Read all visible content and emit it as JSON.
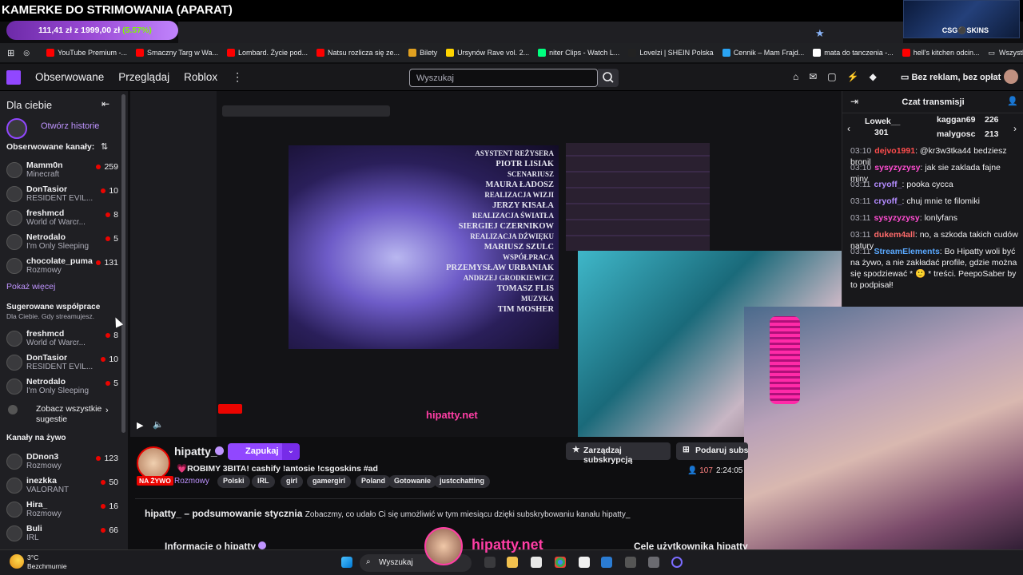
{
  "overlay": {
    "title": "KAMERKE DO STRIMOWANIA (APARAT)",
    "price_prefix": "111,41 zł z 1999,00 zł",
    "price_pct": "(5.57%)",
    "csgo_label": "CSG⚫SKINS"
  },
  "bookmarks": [
    {
      "label": "YouTube Premium -...",
      "color": "#ff0000"
    },
    {
      "label": "Smaczny Targ w Wa...",
      "color": "#ff0000"
    },
    {
      "label": "Lombard. Życie pod...",
      "color": "#ff0000"
    },
    {
      "label": "Natsu rozlicza się ze...",
      "color": "#ff0000"
    },
    {
      "label": "Bilety",
      "color": "#e0a020"
    },
    {
      "label": "Ursynów Rave vol. 2...",
      "color": "#ffd400"
    },
    {
      "label": "niter Clips - Watch L...",
      "color": "#00ff7f"
    },
    {
      "label": "Lovelzi | SHEIN Polska",
      "color": "#222222"
    },
    {
      "label": "Cennik – Mam Frajd...",
      "color": "#2aa4f4"
    },
    {
      "label": "mata do tanczenia -...",
      "color": "#ffffff"
    },
    {
      "label": "hell's kitchen odcin...",
      "color": "#ff0000"
    }
  ],
  "bookmarks_all": "Wszystkie zakładki",
  "nav": {
    "followed": "Obserwowane",
    "browse": "Przeglądaj",
    "roblox": "Roblox",
    "search_placeholder": "Wyszukaj",
    "no_ads": "Bez reklam, bez opłat"
  },
  "sidebar": {
    "for_you": "Dla ciebie",
    "open_stories": "Otwórz historie",
    "followed_header": "Obserwowane kanały:",
    "followed": [
      {
        "name": "Mamm0n",
        "game": "Minecraft",
        "count": "259"
      },
      {
        "name": "DonTasior",
        "game": "RESIDENT EVIL...",
        "count": "10"
      },
      {
        "name": "freshmcd",
        "game": "World of Warcr...",
        "count": "8"
      },
      {
        "name": "Netrodalo",
        "game": "I'm Only Sleeping",
        "count": "5"
      },
      {
        "name": "chocolate_puma",
        "game": "Rozmowy",
        "count": "131"
      }
    ],
    "show_more": "Pokaż więcej",
    "suggested_header": "Sugerowane współprace",
    "suggested_sub": "Dla Ciebie. Gdy streamujesz.",
    "suggested": [
      {
        "name": "freshmcd",
        "game": "World of Warcr...",
        "count": "8"
      },
      {
        "name": "DonTasior",
        "game": "RESIDENT EVIL...",
        "count": "10"
      },
      {
        "name": "Netrodalo",
        "game": "I'm Only Sleeping",
        "count": "5"
      }
    ],
    "see_all_suggestions": "Zobacz wszystkie sugestie",
    "live_header": "Kanały na żywo",
    "live": [
      {
        "name": "DDnon3",
        "game": "Rozmowy",
        "count": "123"
      },
      {
        "name": "inezkka",
        "game": "VALORANT",
        "count": "50"
      },
      {
        "name": "Hira_",
        "game": "Rozmowy",
        "count": "16"
      },
      {
        "name": "Buli",
        "game": "IRL",
        "count": "66"
      }
    ]
  },
  "player": {
    "credits": [
      "ASYSTENT REŻYSERA",
      "PIOTR LISIAK",
      "SCENARIUSZ",
      "MAURA ŁADOSZ",
      "REALIZACJA WIZJI",
      "JERZY KISAŁA",
      "REALIZACJA ŚWIATŁA",
      "SIERGIEJ CZERNIKOW",
      "REALIZACJA DŹWIĘKU",
      "MARIUSZ SZULC",
      "WSPÓŁPRACA",
      "PRZEMYSŁAW URBANIAK",
      "ANDRZEJ GRODKIEWICZ",
      "TOMASZ FLIS",
      "MUZYKA",
      "TIM MOSHER"
    ],
    "inner_watermark": "hipatty.net"
  },
  "channel": {
    "name": "hipatty_",
    "follow": "Zapukaj",
    "live": "NA ŻYWO",
    "title": "💗ROBIMY 3BITA! cashify !antosie !csgoskins #ad",
    "category": "Rozmowy",
    "tags": [
      "Polski",
      "IRL",
      "girl",
      "gamergirl",
      "Poland",
      "Gotowanie",
      "justcchatting"
    ],
    "manage_sub": "Zarządzaj subskrypcją",
    "gift_sub": "Podaruj subsk",
    "viewers": "107",
    "uptime": "2:24:05",
    "summary_title": "hipatty_ – podsumowanie stycznia",
    "summary_text": "Zobaczmy, co udało Ci się umożliwić w tym miesiącu dzięki subskrybowaniu kanału hipatty_",
    "about": "Informacje o hipatty",
    "goals": "Cele użytkownika hipatty"
  },
  "chat": {
    "header": "Czat transmisji",
    "gifters": [
      {
        "name": "Lowek__",
        "count": "301"
      },
      {
        "name": "kaggan69",
        "count": "226"
      },
      {
        "name": "malygosc",
        "count": "213"
      }
    ],
    "messages": [
      {
        "time": "03:10",
        "user": "dejvo1991",
        "color": "#ff4d4d",
        "text": "@kr3w3tka44 bedziesz bronil"
      },
      {
        "time": "03:10",
        "user": "sysyzyzysy",
        "color": "#ff4dd2",
        "text": "jak sie zaklada fajne miny"
      },
      {
        "time": "03:11",
        "user": "cryoff_",
        "color": "#b48cff",
        "text": "pooka cycca"
      },
      {
        "time": "03:11",
        "user": "cryoff_",
        "color": "#b48cff",
        "text": "chuj mnie te filomiki"
      },
      {
        "time": "03:11",
        "user": "sysyzyzysy",
        "color": "#ff4dd2",
        "text": "lonlyfans"
      },
      {
        "time": "03:11",
        "user": "dukem4all",
        "color": "#ff6b6b",
        "text": "no, a szkoda takich cudów natury"
      },
      {
        "time": "03:11",
        "user": "StreamElements",
        "color": "#5aa9ff",
        "text": "Bo Hipatty woli być na żywo, a nie zakładać profile, gdzie można się spodziewać * 🙂 * treści. PeepoSaber by to podpisał!"
      }
    ]
  },
  "branding": {
    "url": "hipatty.net"
  },
  "taskbar": {
    "temp": "3°C",
    "weather": "Bezchmurnie",
    "search": "Wyszukaj"
  }
}
